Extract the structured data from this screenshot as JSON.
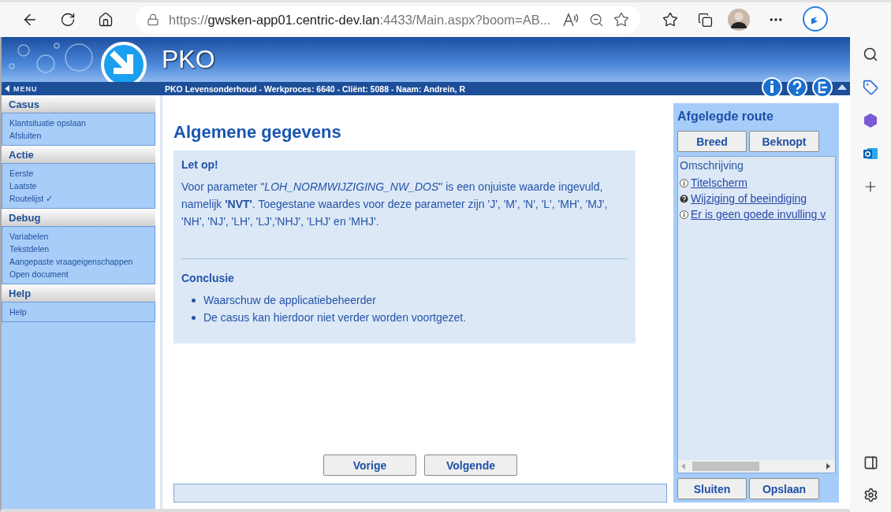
{
  "browser": {
    "url_scheme": "https://",
    "url_host": "gwsken-app01.centric-dev.lan",
    "url_rest": ":4433/Main.aspx?boom=AB..."
  },
  "app": {
    "title": "PKO",
    "menu_label": "MENU",
    "context": "PKO Levensonderhoud - Werkproces: 6640 - Cliënt: 5088 - Naam: Andrein, R"
  },
  "menu": [
    {
      "title": "Casus",
      "items": [
        "Klantsituatie opslaan",
        "Afsluiten"
      ]
    },
    {
      "title": "Actie",
      "items": [
        "Eerste",
        "Laatste",
        "Routelijst ✓"
      ]
    },
    {
      "title": "Debug",
      "items": [
        "Variabelen",
        "Tekstdelen",
        "Aangepaste vraageigenschappen",
        "Open document"
      ]
    },
    {
      "title": "Help",
      "items": [
        "Help"
      ]
    }
  ],
  "main": {
    "heading": "Algemene gegevens",
    "notice": {
      "title": "Let op!",
      "body": "Voor parameter \"*LOH_NORMWIJZIGING_NW_DOS*\" is een onjuiste waarde ingevuld, namelijk **'NVT'**. Toegestane waardes voor deze parameter zijn 'J', 'M', 'N', 'L', 'MH', 'MJ', 'NH', 'NJ', 'LH', 'LJ','NHJ', 'LHJ' en 'MHJ'."
    },
    "conclusion": {
      "title": "Conclusie",
      "bullets": [
        "Waarschuw de applicatiebeheerder",
        "De casus kan hierdoor niet verder worden voortgezet."
      ]
    },
    "buttons": [
      "Vorige",
      "Volgende"
    ]
  },
  "route": {
    "title": "Afgelegde route",
    "view_buttons": [
      "Breed",
      "Beknopt"
    ],
    "list_header": "Omschrijving",
    "items": [
      {
        "kind": "info",
        "label": "Titelscherm"
      },
      {
        "kind": "question",
        "label": "Wijziging of beeindiging"
      },
      {
        "kind": "info",
        "label": "Er is geen goede invulling v"
      }
    ],
    "footer_buttons": [
      "Sluiten",
      "Opslaan"
    ]
  }
}
